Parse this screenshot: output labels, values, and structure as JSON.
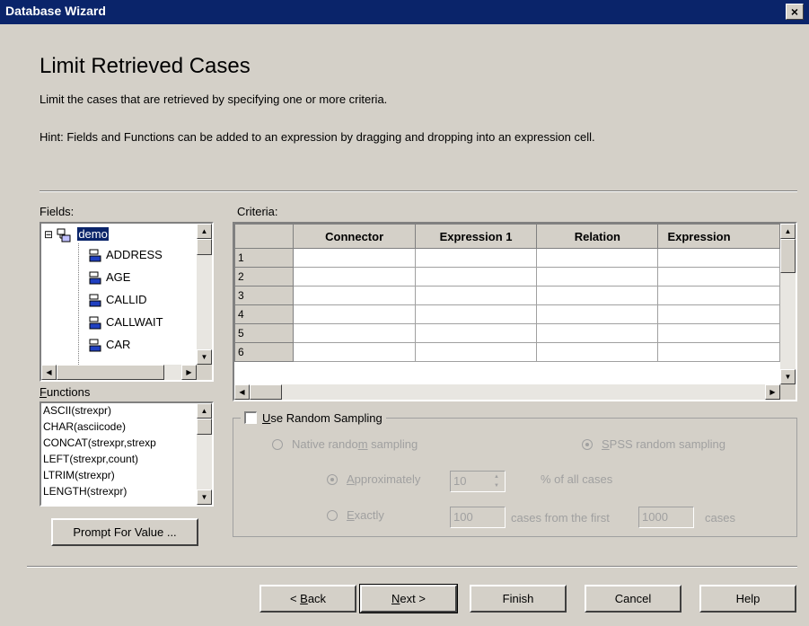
{
  "window": {
    "title": "Database Wizard",
    "close_glyph": "×"
  },
  "page": {
    "title": "Limit Retrieved Cases",
    "subtitle": "Limit the cases that are retrieved by specifying one or more criteria.",
    "hint": "Hint: Fields and Functions can be added to an expression by dragging and dropping into an expression cell."
  },
  "fields": {
    "label": "Fields:",
    "root": "demo",
    "root_toggle": "⊟",
    "items": [
      "ADDRESS",
      "AGE",
      "CALLID",
      "CALLWAIT",
      "CAR"
    ]
  },
  "functions": {
    "label_prefix": "F",
    "label_rest": "unctions",
    "items": [
      "ASCII(strexpr)",
      "CHAR(asciicode)",
      "CONCAT(strexpr,strexp",
      "LEFT(strexpr,count)",
      "LTRIM(strexpr)",
      "LENGTH(strexpr)"
    ]
  },
  "prompt_button": "Prompt For Value ...",
  "criteria": {
    "label": "Criteria:",
    "columns": [
      "Connector",
      "Expression 1",
      "Relation",
      "Expression"
    ],
    "rows": [
      "1",
      "2",
      "3",
      "4",
      "5",
      "6"
    ]
  },
  "sampling": {
    "checkbox_mnemonic": "U",
    "checkbox_rest": "se Random Sampling",
    "native_label_a": "Native rando",
    "native_mnemonic": "m",
    "native_label_b": " sampling",
    "spss_mnemonic": "S",
    "spss_rest": "PSS random sampling",
    "approx_mnemonic": "A",
    "approx_rest": "pproximately",
    "approx_value": "10",
    "percent_label": "% of all cases",
    "exactly_mnemonic": "E",
    "exactly_rest": "xactly",
    "exactly_value": "100",
    "from_first_label": "cases from the first",
    "first_value": "1000",
    "cases_label": "cases"
  },
  "buttons": {
    "back_prefix": "< ",
    "back_mnemonic": "B",
    "back_rest": "ack",
    "next_mnemonic": "N",
    "next_rest": "ext >",
    "finish": "Finish",
    "cancel": "Cancel",
    "help": "Help"
  },
  "colors": {
    "titlebar": "#0a246a",
    "face": "#d4d0c8",
    "selection": "#0a246a"
  },
  "icons": {
    "up": "▲",
    "down": "▼",
    "left": "◀",
    "right": "▶",
    "spin_up": "▲",
    "spin_down": "▼"
  }
}
